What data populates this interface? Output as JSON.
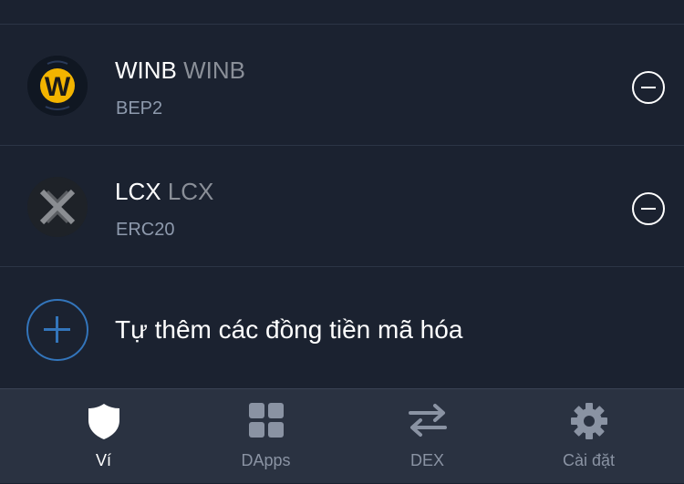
{
  "tokens": [
    {
      "name": "WINB",
      "symbol": "WINB",
      "network": "BEP2",
      "logo_icon": "winb-logo-icon",
      "remove_icon": "minus-circle-icon"
    },
    {
      "name": "LCX",
      "symbol": "LCX",
      "network": "ERC20",
      "logo_icon": "lcx-logo-icon",
      "remove_icon": "minus-circle-icon"
    }
  ],
  "add_token": {
    "label": "Tự thêm các đồng tiền mã hóa",
    "icon": "plus-circle-icon"
  },
  "tabbar": {
    "tabs": [
      {
        "label": "Ví",
        "icon": "shield-icon",
        "active": true
      },
      {
        "label": "DApps",
        "icon": "grid-icon",
        "active": false
      },
      {
        "label": "DEX",
        "icon": "swap-arrows-icon",
        "active": false
      },
      {
        "label": "Cài đặt",
        "icon": "gear-icon",
        "active": false
      }
    ]
  },
  "colors": {
    "background": "#1b2230",
    "tabbar_background": "#2a3241",
    "accent_blue": "#3375bb",
    "text_primary": "#ffffff",
    "text_secondary": "#8e9aad",
    "winb_yellow": "#f3b400"
  }
}
